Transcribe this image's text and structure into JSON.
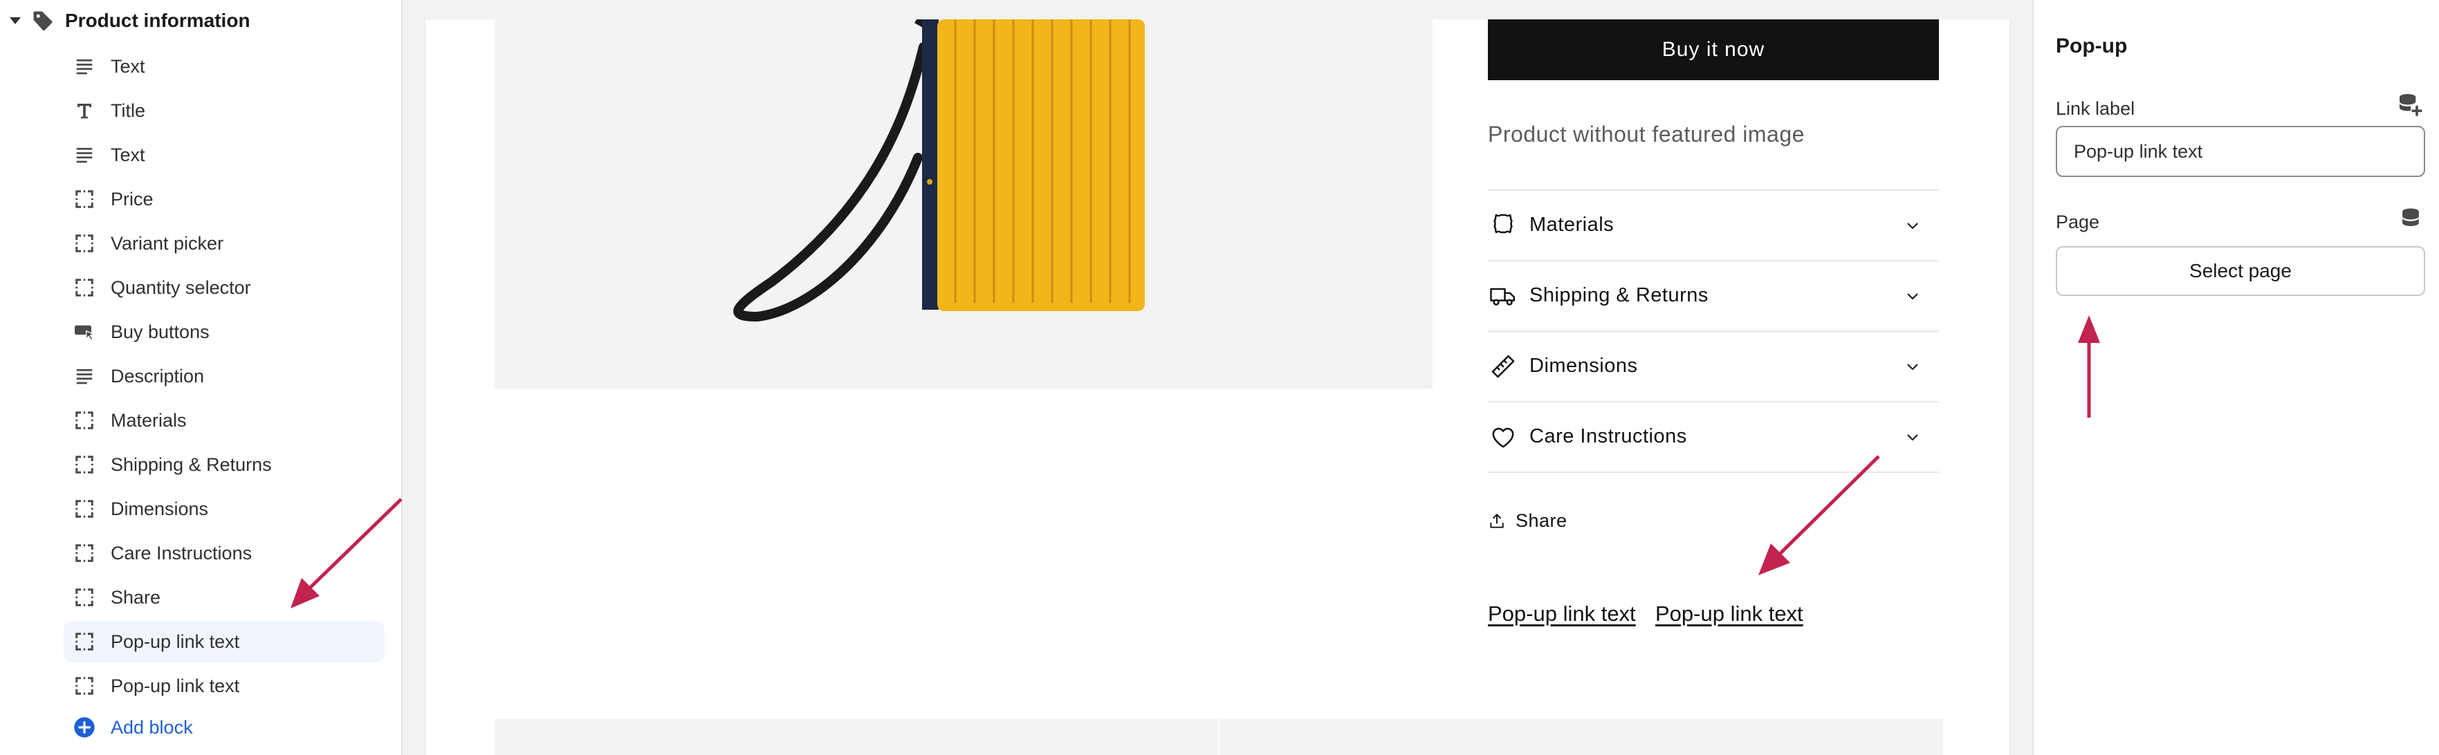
{
  "sidebar": {
    "section_title": "Product information",
    "items": [
      {
        "label": "Text",
        "icon": "text-lines-icon"
      },
      {
        "label": "Title",
        "icon": "title-T-icon"
      },
      {
        "label": "Text",
        "icon": "text-lines-icon"
      },
      {
        "label": "Price",
        "icon": "block-dashed-icon"
      },
      {
        "label": "Variant picker",
        "icon": "block-dashed-icon"
      },
      {
        "label": "Quantity selector",
        "icon": "block-dashed-icon"
      },
      {
        "label": "Buy buttons",
        "icon": "button-cursor-icon"
      },
      {
        "label": "Description",
        "icon": "text-lines-icon"
      },
      {
        "label": "Materials",
        "icon": "block-dashed-icon"
      },
      {
        "label": "Shipping & Returns",
        "icon": "block-dashed-icon"
      },
      {
        "label": "Dimensions",
        "icon": "block-dashed-icon"
      },
      {
        "label": "Care Instructions",
        "icon": "block-dashed-icon"
      },
      {
        "label": "Share",
        "icon": "block-dashed-icon"
      },
      {
        "label": "Pop-up link text",
        "icon": "block-dashed-icon",
        "selected": true
      },
      {
        "label": "Pop-up link text",
        "icon": "block-dashed-icon"
      }
    ],
    "add_block_label": "Add block"
  },
  "preview": {
    "buy_now_label": "Buy it now",
    "no_image_text": "Product without featured image",
    "accordions": [
      {
        "label": "Materials",
        "icon": "leather-hide-icon"
      },
      {
        "label": "Shipping & Returns",
        "icon": "truck-icon"
      },
      {
        "label": "Dimensions",
        "icon": "ruler-icon"
      },
      {
        "label": "Care Instructions",
        "icon": "heart-icon"
      }
    ],
    "share_label": "Share",
    "popup_links": [
      "Pop-up link text",
      "Pop-up link text"
    ]
  },
  "settings": {
    "title": "Pop-up",
    "link_label_label": "Link label",
    "link_label_value": "Pop-up link text",
    "page_label": "Page",
    "select_page_label": "Select page"
  },
  "colors": {
    "accent_link": "#1f5fd6",
    "selected_bg": "#f1f5fe",
    "buy_button": "#121212",
    "annotation_arrow": "#c2234f",
    "product_yellow": "#f2b51a"
  }
}
